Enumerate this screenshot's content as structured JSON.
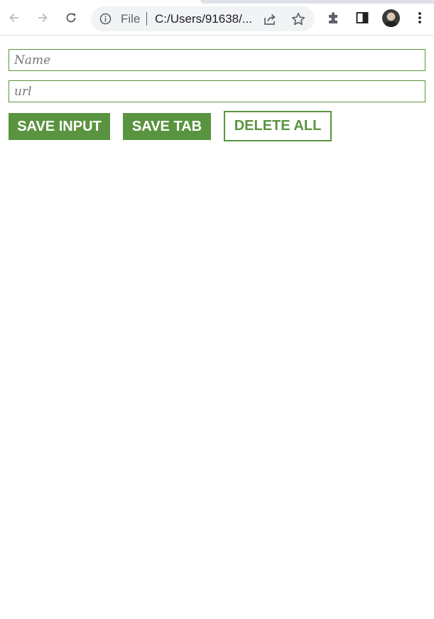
{
  "browser": {
    "omnibox": {
      "scheme_label": "File",
      "url": "C:/Users/91638/..."
    },
    "icons": {
      "back": "arrow-left-icon",
      "forward": "arrow-right-icon",
      "reload": "reload-icon",
      "info": "info-icon",
      "share": "share-icon",
      "bookmark": "star-icon",
      "extensions": "puzzle-icon",
      "side_panel": "side-panel-icon",
      "profile": "avatar",
      "menu": "kebab-menu-icon"
    }
  },
  "form": {
    "name_placeholder": "Name",
    "url_placeholder": "url",
    "name_value": "",
    "url_value": ""
  },
  "buttons": {
    "save_input": "SAVE INPUT",
    "save_tab": "SAVE TAB",
    "delete_all": "DELETE ALL"
  },
  "colors": {
    "accent_green": "#5a9440",
    "toolbar_bg": "#ffffff",
    "omnibox_bg": "#f1f3f4"
  }
}
